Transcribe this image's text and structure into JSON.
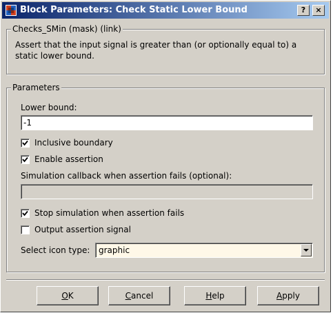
{
  "window": {
    "title": "Block Parameters: Check Static  Lower Bound",
    "help_glyph": "?",
    "close_glyph": "×"
  },
  "mask_group": {
    "legend": "Checks_SMin (mask) (link)",
    "description_line1": "Assert that the input signal is greater than (or optionally equal to) a",
    "description_line2": "static lower bound."
  },
  "params_group": {
    "legend": "Parameters",
    "lower_bound_label": "Lower bound:",
    "lower_bound_value": "-1",
    "inclusive_boundary": {
      "label": "Inclusive boundary",
      "checked": true
    },
    "enable_assertion": {
      "label": "Enable assertion",
      "checked": true
    },
    "callback_label": "Simulation callback when assertion fails (optional):",
    "callback_value": "",
    "stop_simulation": {
      "label": "Stop simulation when assertion fails",
      "checked": true
    },
    "output_signal": {
      "label": "Output assertion signal",
      "checked": false
    },
    "icon_type_label": "Select icon type:",
    "icon_type_value": "graphic"
  },
  "buttons": {
    "ok": {
      "mnemonic": "O",
      "rest": "K"
    },
    "cancel": {
      "mnemonic": "C",
      "rest": "ancel"
    },
    "help": {
      "mnemonic": "H",
      "rest": "elp"
    },
    "apply": {
      "mnemonic": "A",
      "rest": "pply"
    }
  },
  "colors": {
    "titlebar_start": "#0a246a",
    "titlebar_end": "#a6caf0",
    "dialog_face": "#d4d0c8",
    "select_background": "#fff8e8"
  },
  "icons": [
    "simulink-block-icon",
    "help-icon",
    "close-icon",
    "checkmark-icon",
    "dropdown-arrow-icon"
  ]
}
